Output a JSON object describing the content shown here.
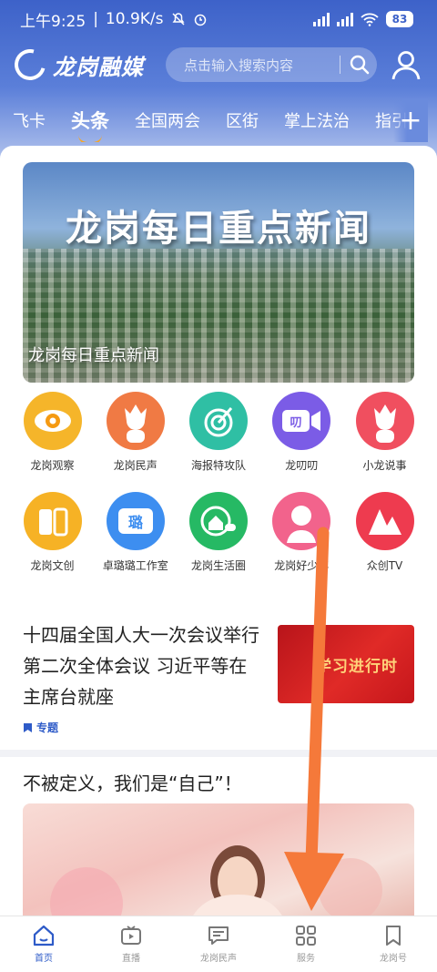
{
  "status_bar": {
    "time": "上午9:25",
    "net_speed": "10.9K/s",
    "battery": "83"
  },
  "header": {
    "logo_text": "龙岗融媒",
    "search_placeholder": "点击输入搜索内容"
  },
  "channel_tabs": [
    {
      "label": "飞卡"
    },
    {
      "label": "头条",
      "active": true
    },
    {
      "label": "全国两会"
    },
    {
      "label": "区街"
    },
    {
      "label": "掌上法治"
    },
    {
      "label": "指引"
    }
  ],
  "banner": {
    "headline": "龙岗每日重点新闻",
    "caption": "龙岗每日重点新闻"
  },
  "quick_grid": [
    [
      {
        "label": "龙岗观察",
        "icon": "eye-icon",
        "color": "#f5b52a"
      },
      {
        "label": "龙岗民声",
        "icon": "dragon-icon",
        "color": "#f07a44"
      },
      {
        "label": "海报特攻队",
        "icon": "target-icon",
        "color": "#2fbfa4"
      },
      {
        "label": "龙叨叨",
        "icon": "video-chat-icon",
        "color": "#7b5ce6"
      },
      {
        "label": "小龙说事",
        "icon": "dragon-icon",
        "color": "#f04f5f"
      }
    ],
    [
      {
        "label": "龙岗文创",
        "icon": "wenchuang-icon",
        "color": "#f6b225"
      },
      {
        "label": "卓璐璐工作室",
        "icon": "studio-icon",
        "color": "#3d8ef0"
      },
      {
        "label": "龙岗生活圈",
        "icon": "home-icon",
        "color": "#26b964"
      },
      {
        "label": "龙岗好少年",
        "icon": "person-icon",
        "color": "#f2638c"
      },
      {
        "label": "众创TV",
        "icon": "tv-icon",
        "color": "#ee3b4f"
      }
    ]
  ],
  "news": {
    "title": "十四届全国人大一次会议举行第二次全体会议 习近平等在主席台就座",
    "tag": "专题",
    "thumb_text": "学习进行时"
  },
  "article": {
    "title": "不被定义，我们是“自己”！"
  },
  "bottom_nav": [
    {
      "label": "首页",
      "icon": "home-icon",
      "active": true
    },
    {
      "label": "直播",
      "icon": "tv-icon"
    },
    {
      "label": "龙岗民声",
      "icon": "message-icon"
    },
    {
      "label": "服务",
      "icon": "grid-icon"
    },
    {
      "label": "龙岗号",
      "icon": "bookmark-icon"
    }
  ],
  "colors": {
    "brand": "#3d62c9",
    "accent": "#f4a62a",
    "active_nav": "#2e5bc8",
    "arrow": "#f5793a"
  }
}
